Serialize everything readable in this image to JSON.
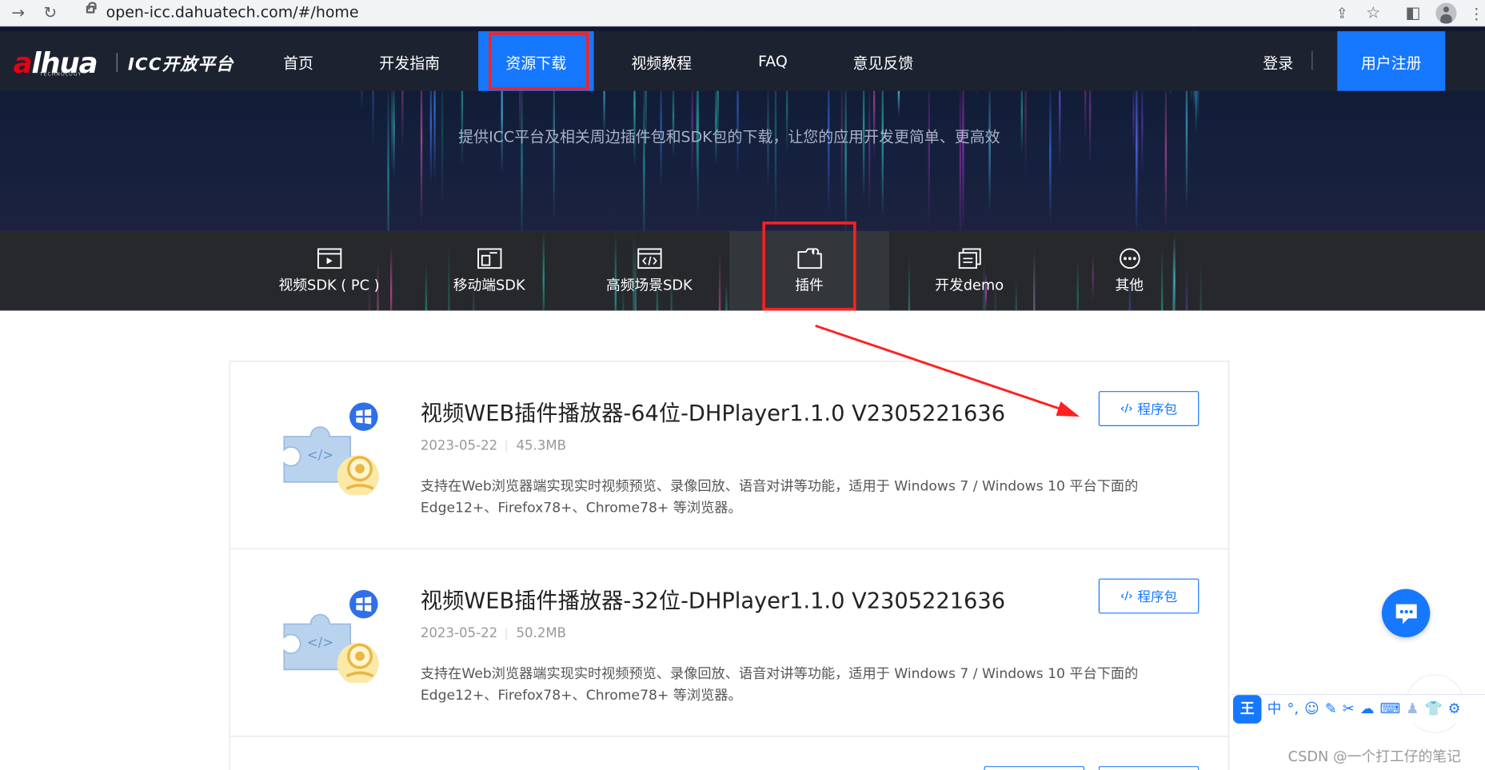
{
  "browser": {
    "url": "open-icc.dahuatech.com/#/home"
  },
  "header": {
    "logo_text": "alhua",
    "logo_sub": "TECHNOLOGY",
    "platform": "ICC开放平台",
    "nav": [
      "首页",
      "开发指南",
      "资源下载",
      "视频教程",
      "FAQ",
      "意见反馈"
    ],
    "active_nav": "资源下载",
    "login": "登录",
    "register": "用户注册"
  },
  "hero": {
    "subtitle": "提供ICC平台及相关周边插件包和SDK包的下载，让您的应用开发更简单、更高效"
  },
  "categories": [
    {
      "label": "视频SDK ( PC )",
      "icon": "video-player-icon"
    },
    {
      "label": "移动端SDK",
      "icon": "mobile-window-icon"
    },
    {
      "label": "高频场景SDK",
      "icon": "code-window-icon"
    },
    {
      "label": "插件",
      "icon": "plugin-folder-icon"
    },
    {
      "label": "开发demo",
      "icon": "document-stack-icon"
    },
    {
      "label": "其他",
      "icon": "more-icon"
    }
  ],
  "active_category": "插件",
  "items": [
    {
      "title": "视频WEB插件播放器-64位-DHPlayer1.1.0 V2305221636",
      "date": "2023-05-22",
      "size": "45.3MB",
      "description": "支持在Web浏览器端实现实时视频预览、录像回放、语音对讲等功能，适用于 Windows 7 / Windows 10 平台下面的 Edge12+、Firefox78+、Chrome78+ 等浏览器。",
      "button": "程序包"
    },
    {
      "title": "视频WEB插件播放器-32位-DHPlayer1.1.0 V2305221636",
      "date": "2023-05-22",
      "size": "50.2MB",
      "description": "支持在Web浏览器端实现实时视频预览、录像回放、语音对讲等功能，适用于 Windows 7 / Windows 10 平台下面的 Edge12+、Firefox78+、Chrome78+ 等浏览器。",
      "button": "程序包"
    }
  ],
  "ime": {
    "mode": "中"
  },
  "watermark": "CSDN @一个打工仔的笔记",
  "colors": {
    "brand_blue": "#1677ff",
    "nav_bg": "#1d2230",
    "highlight_red": "#ff2020"
  }
}
